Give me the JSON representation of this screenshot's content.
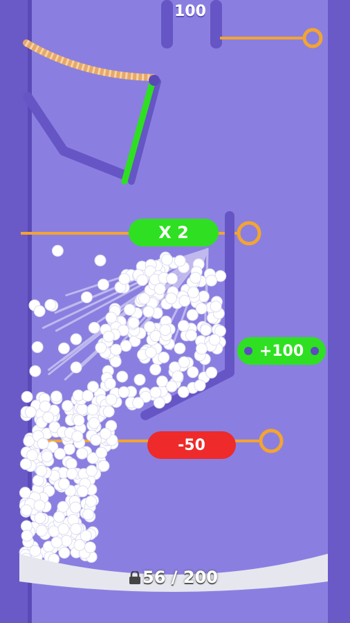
{
  "hud": {
    "top_score": "100",
    "progress_label": "56 / 200"
  },
  "gates": {
    "multiplier_label": "X 2",
    "bonus_label": "+100",
    "penalty_label": "-50"
  },
  "colors": {
    "background": "#8a7fe0",
    "wall": "#6655c4",
    "pin": "#f3a431",
    "multiplier_gate": "#2ee021",
    "bonus_gate": "#2ee021",
    "penalty_gate": "#ee2a2a",
    "green_bar": "#2ee021",
    "ball": "#ffffff",
    "tray": "#e6e6ef"
  },
  "icons": {
    "lock": "lock-icon"
  }
}
